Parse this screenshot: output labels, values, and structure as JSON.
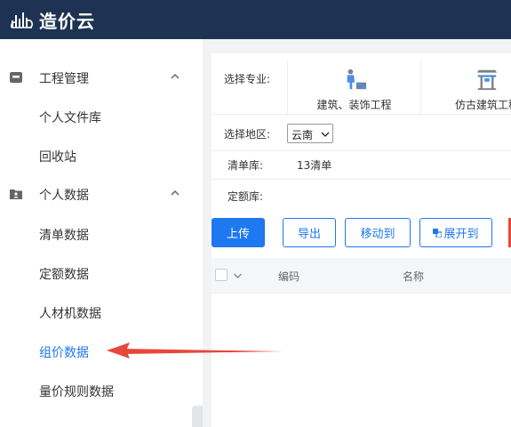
{
  "app": {
    "title": "造价云"
  },
  "sidebar": {
    "groups": [
      {
        "label": "工程管理",
        "icon": "inbox-icon",
        "expanded": true
      },
      {
        "label": "个人数据",
        "icon": "folder-user-icon",
        "expanded": true
      }
    ],
    "items": [
      {
        "label": "个人文件库",
        "active": false
      },
      {
        "label": "回收站",
        "active": false
      },
      {
        "label": "清单数据",
        "active": false
      },
      {
        "label": "定额数据",
        "active": false
      },
      {
        "label": "人材机数据",
        "active": false
      },
      {
        "label": "组价数据",
        "active": true
      },
      {
        "label": "量价规则数据",
        "active": false
      }
    ]
  },
  "filters": {
    "specialty_label": "选择专业:",
    "specialties": [
      {
        "label": "建筑、装饰工程",
        "icon": "worker-icon"
      },
      {
        "label": "仿古建筑工程",
        "icon": "pavilion-icon"
      }
    ],
    "region_label": "选择地区:",
    "region_value": "云南",
    "bill_label": "清单库:",
    "bill_value": "13清单",
    "quota_label": "定额库:",
    "quota_value": ""
  },
  "toolbar": {
    "upload": "上传",
    "export": "导出",
    "move": "移动到",
    "expand": "展开到"
  },
  "table": {
    "columns": [
      "编码",
      "名称"
    ]
  },
  "colors": {
    "topbar": "#1e3353",
    "accent": "#1e78f0",
    "annotation_arrow": "#e8473b"
  }
}
